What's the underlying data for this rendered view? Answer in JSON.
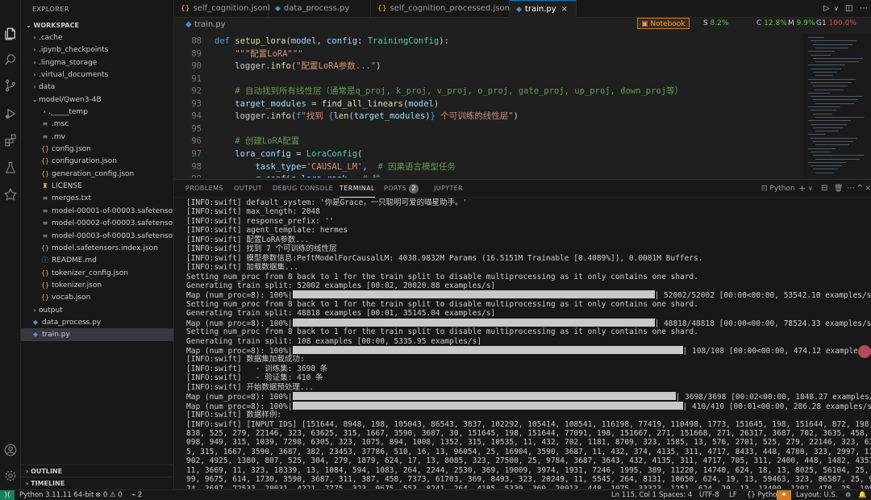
{
  "sidebar": {
    "header": "EXPLORER",
    "workspace": "WORKSPACE",
    "items": [
      {
        "label": ".cache",
        "type": "folder",
        "indent": 0,
        "icon": "chevron-right-icon"
      },
      {
        "label": ".ipynb_checkpoints",
        "type": "folder",
        "indent": 0,
        "icon": "chevron-right-icon"
      },
      {
        "label": ".lingma_storage",
        "type": "folder",
        "indent": 0,
        "icon": "chevron-right-icon"
      },
      {
        "label": ".virtual_documents",
        "type": "folder",
        "indent": 0,
        "icon": "chevron-right-icon"
      },
      {
        "label": "data",
        "type": "folder",
        "indent": 0,
        "icon": "chevron-right-icon"
      },
      {
        "label": "model/Qwen3-4B",
        "type": "folder-open",
        "indent": 0,
        "icon": "chevron-down-icon"
      },
      {
        "label": "._____temp",
        "type": "folder",
        "indent": 1,
        "icon": "chevron-right-icon"
      },
      {
        "label": ".msc",
        "type": "file-lines",
        "indent": 1,
        "icon": "lines-file-icon"
      },
      {
        "label": ".mv",
        "type": "file-lines",
        "indent": 1,
        "icon": "lines-file-icon"
      },
      {
        "label": "config.json",
        "type": "json",
        "indent": 1,
        "icon": "json-icon"
      },
      {
        "label": "configuration.json",
        "type": "json",
        "indent": 1,
        "icon": "json-icon"
      },
      {
        "label": "generation_config.json",
        "type": "json",
        "indent": 1,
        "icon": "json-icon"
      },
      {
        "label": "LICENSE",
        "type": "license",
        "indent": 1,
        "icon": "license-icon"
      },
      {
        "label": "merges.txt",
        "type": "file-lines",
        "indent": 1,
        "icon": "lines-file-icon"
      },
      {
        "label": "model-00001-of-00003.safetensors",
        "type": "file-lines",
        "indent": 1,
        "icon": "lines-file-icon"
      },
      {
        "label": "model-00002-of-00003.safetensors",
        "type": "file-lines",
        "indent": 1,
        "icon": "lines-file-icon"
      },
      {
        "label": "model-00003-of-00003.safetensors",
        "type": "file-lines",
        "indent": 1,
        "icon": "lines-file-icon"
      },
      {
        "label": "model.safetensors.index.json",
        "type": "json",
        "indent": 1,
        "icon": "json-icon"
      },
      {
        "label": "README.md",
        "type": "info",
        "indent": 1,
        "icon": "info-icon"
      },
      {
        "label": "tokenizer_config.json",
        "type": "json",
        "indent": 1,
        "icon": "json-icon"
      },
      {
        "label": "tokenizer.json",
        "type": "json",
        "indent": 1,
        "icon": "json-icon"
      },
      {
        "label": "vocab.json",
        "type": "json",
        "indent": 1,
        "icon": "json-icon"
      },
      {
        "label": "output",
        "type": "folder",
        "indent": 0,
        "icon": "chevron-right-icon"
      },
      {
        "label": "data_process.py",
        "type": "py",
        "indent": -1,
        "icon": "python-icon"
      },
      {
        "label": "train.py",
        "type": "py",
        "indent": -1,
        "icon": "python-icon",
        "selected": true
      }
    ],
    "outline": "OUTLINE",
    "timeline": "TIMELINE"
  },
  "tabs": [
    {
      "label": "self_cognition.jsonl",
      "icon": "{}"
    },
    {
      "label": "data_process.py",
      "icon": "py"
    },
    {
      "label": "self_cognition_processed.jsonl",
      "icon": "{}"
    },
    {
      "label": "train.py",
      "icon": "py",
      "active": true,
      "close": "×"
    }
  ],
  "toolbar": {
    "notebook": "Notebook",
    "s_label": "S",
    "s_value": "8.2%",
    "c_label": "C",
    "c_value": "12.8%",
    "m_label": "M",
    "m_value": "9.9%",
    "g_label": "G1",
    "g_value": "100.0%"
  },
  "breadcrumb": "train.py",
  "editor": {
    "lines": [
      {
        "n": "88",
        "html": "<span class='kw'>def</span> <span class='fn'>setup_lora</span>(<span class='pm'>model</span>, <span class='pm'>config</span>: <span class='cls'>TrainingConfig</span>):"
      },
      {
        "n": "89",
        "html": "    <span class='str'>\"\"\"配置LoRA\"\"\"</span>"
      },
      {
        "n": "90",
        "html": "    logger.<span class='fn'>info</span>(<span class='str'>\"配置LoRA参数...\"</span>)"
      },
      {
        "n": "91",
        "html": ""
      },
      {
        "n": "92",
        "html": "    <span class='cm'># 自动找到所有线性层（通常是q_proj, k_proj, v_proj, o_proj, gate_proj, up_proj, down_proj等）</span>"
      },
      {
        "n": "93",
        "html": "    <span class='pm'>target_modules</span> = <span class='fn'>find_all_linears</span>(<span class='pm'>model</span>)"
      },
      {
        "n": "94",
        "html": "    logger.<span class='fn'>info</span>(<span class='kw'>f</span><span class='str'>\"找到 </span><span class='kw'>{</span><span class='fn'>len</span>(<span class='pm'>target_modules</span>)<span class='kw'>}</span><span class='str'> 个可训练的线性层\"</span>)"
      },
      {
        "n": "95",
        "html": ""
      },
      {
        "n": "96",
        "html": "    <span class='cm'># 创建LoRA配置</span>"
      },
      {
        "n": "97",
        "html": "    <span class='pm'>lora_config</span> = <span class='cls'>LoraConfig</span>("
      },
      {
        "n": "98",
        "html": "        <span class='pm'>task_type</span>=<span class='str'>'CAUSAL_LM'</span>,  <span class='cm'># 因果语言模型任务</span>"
      },
      {
        "n": "99",
        "html": "        <span class='pm'>r</span>=<span class='pm'>config</span>.<span class='pm'>lora_rank</span>,  <span class='cm'># 秩</span>"
      }
    ]
  },
  "panel": {
    "tabs": [
      "PROBLEMS",
      "OUTPUT",
      "DEBUG CONSOLE",
      "TERMINAL",
      "PORTS",
      "JUPYTER"
    ],
    "ports_count": "2",
    "shell": "Python",
    "actions": [
      "+",
      "∨",
      "⊟",
      "🗑",
      "⋯",
      "^",
      "×"
    ]
  },
  "terminal": [
    {
      "t": "[INFO:swift] default_system: '你是Grace，一只聪明可爱的喵星助手。'"
    },
    {
      "t": "[INFO:swift] max_length: 2048"
    },
    {
      "t": "[INFO:swift] response_prefix: ''"
    },
    {
      "t": "[INFO:swift] agent_template: hermes"
    },
    {
      "t": "[INFO:swift] 配置LoRA参数..."
    },
    {
      "t": "[INFO:swift] 找到 7 个可训练的线性层"
    },
    {
      "t": "[INFO:swift] 模型参数信息:PeftModelForCausalLM: 4038.9832M Params (16.5151M Trainable [0.4089%]), 0.0001M Buffers."
    },
    {
      "t": "[INFO:swift] 加载数据集..."
    },
    {
      "t": "Setting num_proc from 8 back to 1 for the train split to disable multiprocessing as it only contains one shard."
    },
    {
      "t": "Generating train split: 52002 examples [00:02, 20020.88 examples/s]"
    },
    {
      "pre": "Map (num_proc=8): 100%|",
      "bar": 0.52,
      "post": "| 52002/52002 [00:00<00:00, 53542.10 examples/s]"
    },
    {
      "t": "Setting num_proc from 8 back to 1 for the train split to disable multiprocessing as it only contains one shard."
    },
    {
      "t": "Generating train split: 48818 examples [00:01, 35145.04 examples/s]"
    },
    {
      "pre": "Map (num_proc=8): 100%|",
      "bar": 0.52,
      "post": "| 48818/48818 [00:00<00:00, 78524.33 examples/s]"
    },
    {
      "t": "Setting num_proc from 8 back to 1 for the train split to disable multiprocessing as it only contains one shard."
    },
    {
      "t": "Generating train split: 108 examples [00:00, 5335.95 examples/s]"
    },
    {
      "pre": "Map (num_proc=8): 100%|",
      "bar": 0.56,
      "post": "| 108/108 [00:00<00:00, 474.12 examples/s]"
    },
    {
      "t": "[INFO:swift] 数据集加载成功:"
    },
    {
      "t": "[INFO:swift]   - 训练集: 3698 条"
    },
    {
      "t": "[INFO:swift]   - 验证集: 410 条"
    },
    {
      "t": "[INFO:swift] 开始数据预处理..."
    },
    {
      "pre": "Map (num_proc=8): 100%|",
      "bar": 0.55,
      "post": "| 3698/3698 [00:02<00:00, 1848.27 examples/s]"
    },
    {
      "pre": "Map (num_proc=8): 100%|",
      "bar": 0.56,
      "post": "| 410/410 [00:01<00:00, 286.28 examples/s]"
    },
    {
      "t": "[INFO:swift] 数据样例:"
    },
    {
      "t": "[INFO:swift] [INPUT_IDS] [151644, 8948, 198, 105043, 86543, 3837, 102292, 105414, 108541, 116198, 77419, 110498, 1773, 151645, 198, 151644, 872, 198, 3"
    },
    {
      "t": "838, 525, 279, 22146, 323, 63625, 315, 1667, 3590, 3687, 30, 151645, 198, 151644, 77091, 198, 151667, 271, 151668, 271, 26317, 3687, 702, 3635, 458, 25"
    },
    {
      "t": "098, 949, 315, 1039, 7298, 6305, 323, 1075, 894, 1008, 1352, 315, 10535, 11, 432, 702, 1181, 8709, 323, 1585, 13, 576, 2701, 525, 279, 22146, 323, 6362"
    },
    {
      "t": "5, 315, 1667, 3590, 3687, 382, 23453, 37786, 510, 16, 13, 96054, 25, 16904, 3590, 3687, 11, 432, 374, 4135, 311, 4717, 8433, 448, 4780, 323, 2997, 11,"
    },
    {
      "t": "902, 4925, 1380, 807, 525, 304, 279, 1879, 624, 17, 13, 8085, 323, 27500, 25, 9784, 3687, 3643, 432, 4135, 311, 4717, 705, 311, 2400, 448, 1482, 4357,"
    },
    {
      "t": "11, 3669, 11, 323, 18339, 13, 1084, 594, 1083, 264, 2244, 2530, 369, 19009, 3974, 1931, 7246, 1995, 389, 11220, 14740, 624, 18, 13, 8025, 56104, 25, 89"
    },
    {
      "t": "99, 9675, 614, 1730, 3590, 3687, 311, 387, 458, 7373, 61703, 369, 8493, 323, 20249, 11, 5545, 264, 8131, 10650, 624, 19, 13, 59463, 323, 86587, 25, 97"
    },
    {
      "t": "74, 3687, 72533, 20031, 4221, 7775, 323, 9675, 553, 8241, 264, 4185, 5339, 369, 20913, 448, 1075, 33323, 1251, 624, 20, 13, 13409, 1202, 478, 25, 1084,"
    }
  ],
  "status": {
    "remote": "⟩⟨",
    "python": "Python 3.11.11 64-bit",
    "errors": "0",
    "warnings": "0",
    "ports": "2",
    "position": "Ln 115, Col 1",
    "spaces": "Spaces: 4",
    "encoding": "UTF-8",
    "eol": "LF",
    "language": "Python",
    "layout": "Layout: U.S."
  },
  "colors": {
    "accent": "#0078d4",
    "stat_s": "#6dbf5b",
    "stat_c": "#6dbf5b",
    "stat_m": "#6dbf5b",
    "stat_g": "#e05252"
  }
}
